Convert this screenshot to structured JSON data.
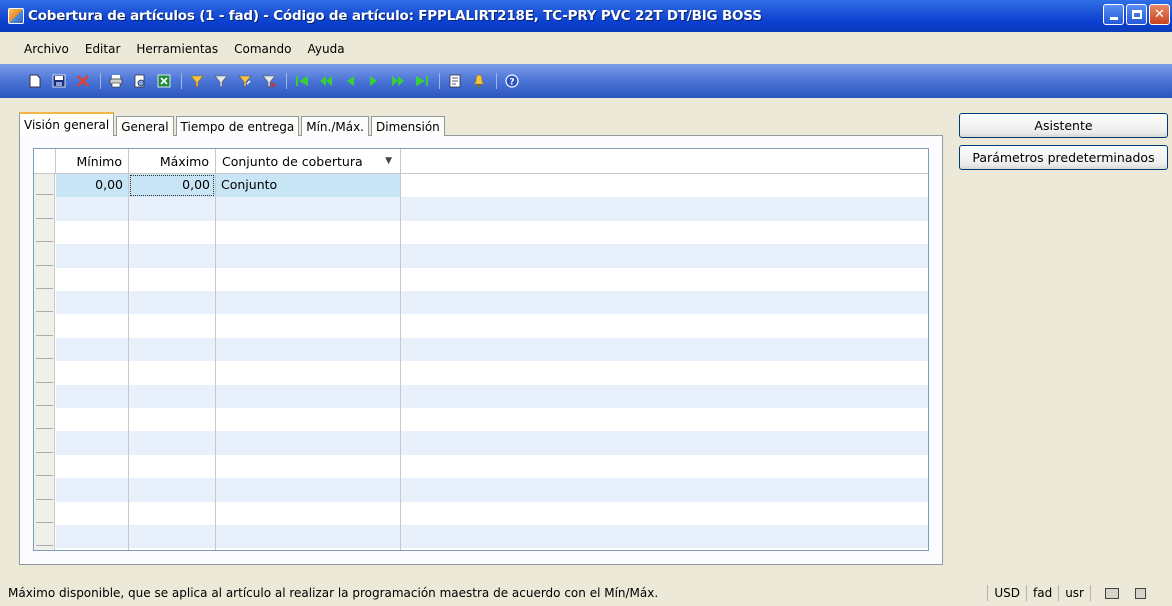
{
  "window": {
    "title": "Cobertura de artículos (1 - fad) - Código de artículo: FPPLALIRT218E, TC-PRY PVC 22T DT/BIG BOSS"
  },
  "menu": [
    "Archivo",
    "Editar",
    "Herramientas",
    "Comando",
    "Ayuda"
  ],
  "toolbar": {
    "icons": [
      "new-record-icon",
      "save-icon",
      "delete-icon",
      "print-icon",
      "print-preview-icon",
      "export-excel-icon",
      "filter-by-selection-icon",
      "filter-by-grid-icon",
      "advanced-filter-icon",
      "remove-filter-icon",
      "first-record-icon",
      "previous-page-icon",
      "previous-record-icon",
      "next-record-icon",
      "next-page-icon",
      "last-record-icon",
      "document-handling-icon",
      "alert-icon",
      "help-icon"
    ]
  },
  "tabs": [
    "Visión general",
    "General",
    "Tiempo de entrega",
    "Mín./Máx.",
    "Dimensión"
  ],
  "grid": {
    "columns": [
      "Mínimo",
      "Máximo",
      "Conjunto de cobertura"
    ],
    "rows": [
      {
        "minimo": "0,00",
        "maximo": "0,00",
        "conjunto": "Conjunto"
      }
    ]
  },
  "side_buttons": {
    "wizard": "Asistente",
    "defaults": "Parámetros predeterminados"
  },
  "status": {
    "text": "Máximo disponible, que se aplica al artículo al realizar la programación maestra de acuerdo con el Mín/Máx.",
    "currency": "USD",
    "company": "fad",
    "layer": "usr"
  },
  "colors": {
    "titlebar": "#0a3fd0",
    "toolbar": "#4f77d8",
    "row_alt": "#e8f0fb",
    "row_selected": "#c8e5f6",
    "active_tab_accent": "#f8b443"
  }
}
